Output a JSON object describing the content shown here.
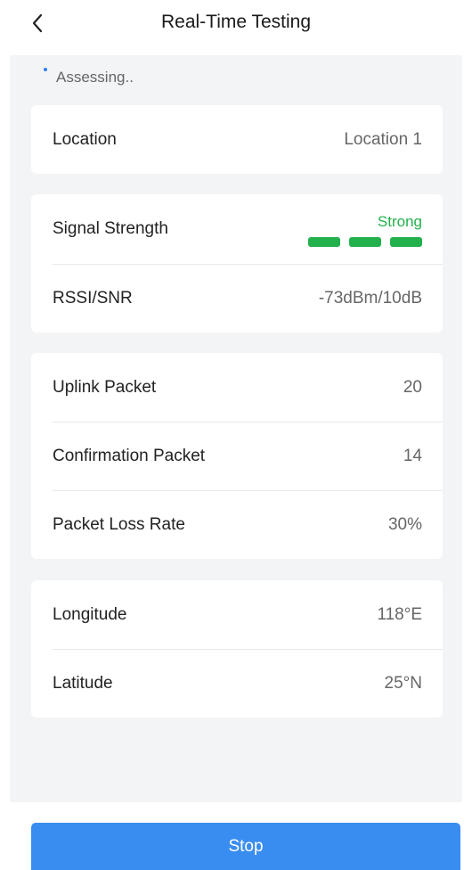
{
  "header": {
    "title": "Real-Time Testing",
    "back_icon": "chevron-left-icon"
  },
  "status": {
    "text": "Assessing.."
  },
  "location": {
    "label": "Location",
    "value": "Location 1"
  },
  "signal": {
    "strength_label": "Signal Strength",
    "strength_value": "Strong",
    "bars_filled": 3,
    "bars_total": 3,
    "color": "#22b14c",
    "rssi_label": "RSSI/SNR",
    "rssi_value": "-73dBm/10dB"
  },
  "packets": {
    "uplink_label": "Uplink Packet",
    "uplink_value": "20",
    "confirmation_label": "Confirmation Packet",
    "confirmation_value": "14",
    "loss_label": "Packet Loss Rate",
    "loss_value": "30%"
  },
  "position": {
    "longitude_label": "Longitude",
    "longitude_value": "118°E",
    "latitude_label": "Latitude",
    "latitude_value": "25°N"
  },
  "actions": {
    "stop_label": "Stop",
    "accent": "#3a8df0"
  }
}
